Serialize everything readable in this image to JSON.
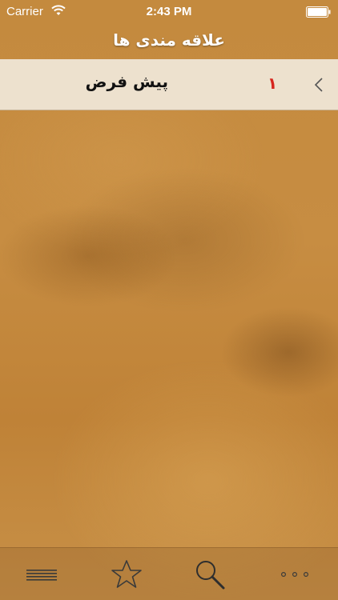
{
  "status_bar": {
    "carrier": "Carrier",
    "time": "2:43 PM",
    "icons": [
      "wifi-icon",
      "battery-icon"
    ]
  },
  "nav_bar": {
    "title": "علاقه مندی ها"
  },
  "list": {
    "items": [
      {
        "number": "١",
        "title": "پیش فرض",
        "icon": "chevron-left-icon"
      }
    ]
  },
  "tab_bar": {
    "items": [
      {
        "icon": "menu-icon"
      },
      {
        "icon": "star-icon"
      },
      {
        "icon": "search-icon"
      },
      {
        "icon": "more-dots-icon"
      }
    ]
  },
  "colors": {
    "accent_number": "#d6261f",
    "row_background": "#f0e8da",
    "nav_text": "#ffffff"
  }
}
